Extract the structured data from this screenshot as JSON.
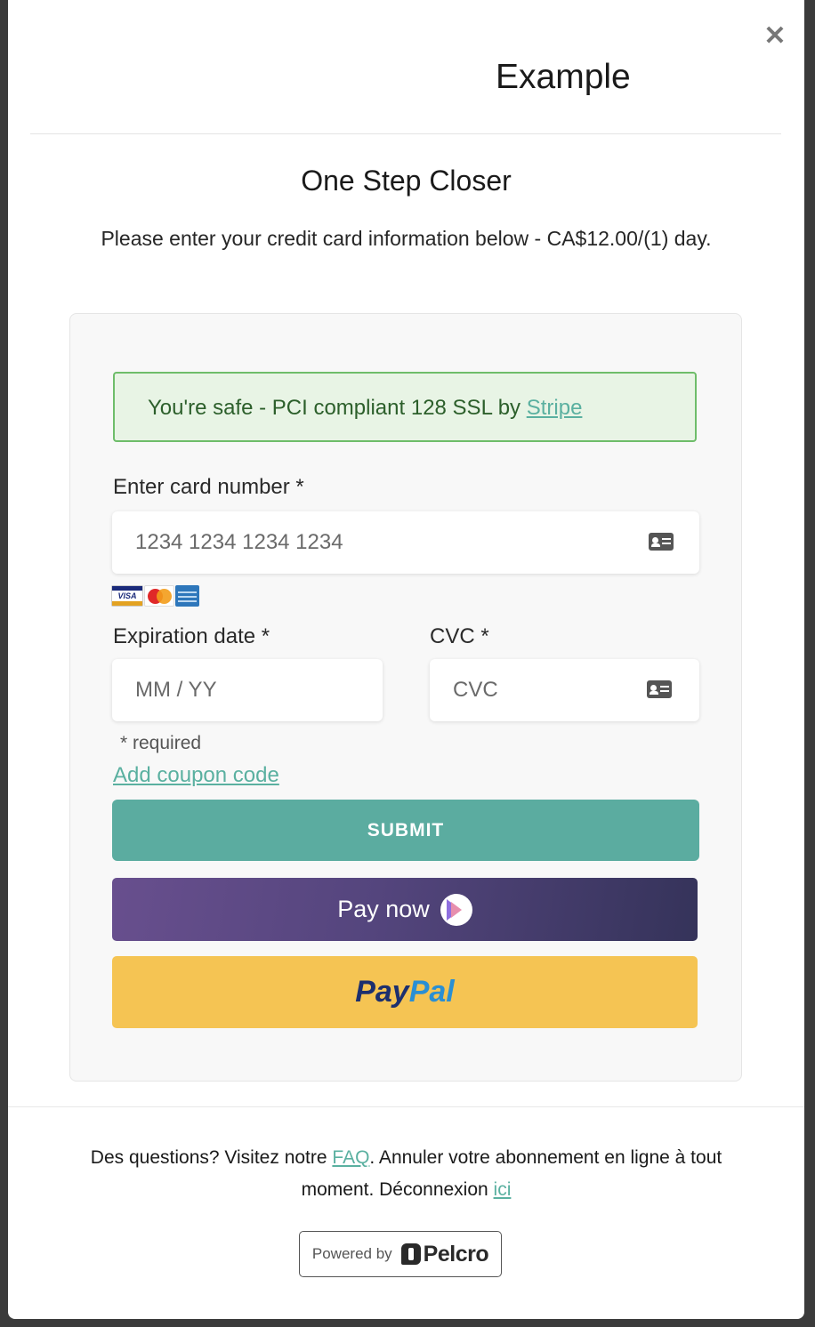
{
  "modal": {
    "site_title": "Example",
    "close_symbol": "✕"
  },
  "step": {
    "title": "One Step Closer",
    "description": "Please enter your credit card information below - CA$12.00/(1) day."
  },
  "security_notice": {
    "text": "You're safe - PCI compliant 128 SSL by ",
    "link_label": "Stripe"
  },
  "card_number": {
    "label": "Enter card number *",
    "placeholder": "1234 1234 1234 1234",
    "icon": "card-icon"
  },
  "accepted_brands": [
    "VISA",
    "MasterCard",
    "American Express"
  ],
  "expiration": {
    "label": "Expiration date *",
    "placeholder": "MM / YY"
  },
  "cvc": {
    "label": "CVC *",
    "placeholder": "CVC",
    "icon": "card-icon"
  },
  "required_note": "* required",
  "coupon_link": "Add coupon code",
  "buttons": {
    "submit": "SUBMIT",
    "paynow": "Pay now",
    "paypal_a": "Pay",
    "paypal_b": "Pal"
  },
  "footer": {
    "text_1": "Des questions? Visitez notre ",
    "faq_link": "FAQ",
    "text_2": ". Annuler votre abonnement en ligne à tout moment. Déconnexion ",
    "logout_link": "ici"
  },
  "powered_by": {
    "label": "Powered by",
    "brand": "Pelcro"
  },
  "colors": {
    "accent": "#5baca0",
    "alert_bg": "#e8f4e5",
    "alert_border": "#6ebd6a",
    "paypal": "#f5c453",
    "paynow_start": "#684f8e",
    "paynow_end": "#35335a"
  }
}
